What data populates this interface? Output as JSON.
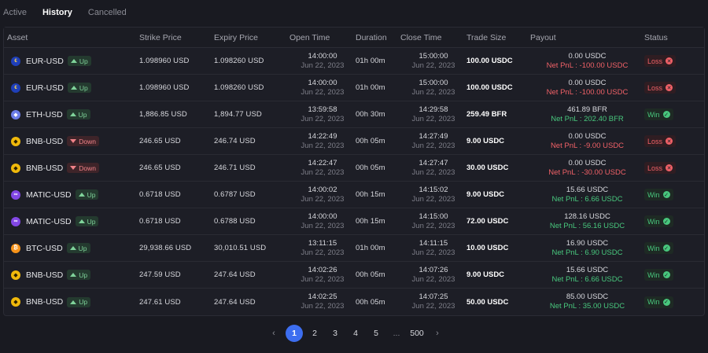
{
  "tabs": [
    {
      "label": "Active",
      "active": false
    },
    {
      "label": "History",
      "active": true
    },
    {
      "label": "Cancelled",
      "active": false
    }
  ],
  "columns": {
    "asset": "Asset",
    "strike": "Strike Price",
    "expiry": "Expiry Price",
    "open": "Open Time",
    "duration": "Duration",
    "close": "Close Time",
    "size": "Trade Size",
    "payout": "Payout",
    "status": "Status"
  },
  "rows": [
    {
      "coin": "eur",
      "coin_glyph": "€",
      "asset": "EUR-USD",
      "dir": "up",
      "dir_label": "Up",
      "strike": "1.098960 USD",
      "expiry": "1.098260 USD",
      "open_time": "14:00:00",
      "open_date": "Jun 22, 2023",
      "duration": "01h 00m",
      "close_time": "15:00:00",
      "close_date": "Jun 22, 2023",
      "size": "100.00 USDC",
      "payout": "0.00 USDC",
      "pnl": "Net PnL : -100.00 USDC",
      "result": "loss",
      "status": "Loss"
    },
    {
      "coin": "eur",
      "coin_glyph": "€",
      "asset": "EUR-USD",
      "dir": "up",
      "dir_label": "Up",
      "strike": "1.098960 USD",
      "expiry": "1.098260 USD",
      "open_time": "14:00:00",
      "open_date": "Jun 22, 2023",
      "duration": "01h 00m",
      "close_time": "15:00:00",
      "close_date": "Jun 22, 2023",
      "size": "100.00 USDC",
      "payout": "0.00 USDC",
      "pnl": "Net PnL : -100.00 USDC",
      "result": "loss",
      "status": "Loss"
    },
    {
      "coin": "eth",
      "coin_glyph": "◆",
      "asset": "ETH-USD",
      "dir": "up",
      "dir_label": "Up",
      "strike": "1,886.85 USD",
      "expiry": "1,894.77 USD",
      "open_time": "13:59:58",
      "open_date": "Jun 22, 2023",
      "duration": "00h 30m",
      "close_time": "14:29:58",
      "close_date": "Jun 22, 2023",
      "size": "259.49 BFR",
      "payout": "461.89 BFR",
      "pnl": "Net PnL : 202.40 BFR",
      "result": "win",
      "status": "Win"
    },
    {
      "coin": "bnb",
      "coin_glyph": "◆",
      "asset": "BNB-USD",
      "dir": "down",
      "dir_label": "Down",
      "strike": "246.65 USD",
      "expiry": "246.74 USD",
      "open_time": "14:22:49",
      "open_date": "Jun 22, 2023",
      "duration": "00h 05m",
      "close_time": "14:27:49",
      "close_date": "Jun 22, 2023",
      "size": "9.00 USDC",
      "payout": "0.00 USDC",
      "pnl": "Net PnL : -9.00 USDC",
      "result": "loss",
      "status": "Loss"
    },
    {
      "coin": "bnb",
      "coin_glyph": "◆",
      "asset": "BNB-USD",
      "dir": "down",
      "dir_label": "Down",
      "strike": "246.65 USD",
      "expiry": "246.71 USD",
      "open_time": "14:22:47",
      "open_date": "Jun 22, 2023",
      "duration": "00h 05m",
      "close_time": "14:27:47",
      "close_date": "Jun 22, 2023",
      "size": "30.00 USDC",
      "payout": "0.00 USDC",
      "pnl": "Net PnL : -30.00 USDC",
      "result": "loss",
      "status": "Loss"
    },
    {
      "coin": "matic",
      "coin_glyph": "∞",
      "asset": "MATIC-USD",
      "dir": "up",
      "dir_label": "Up",
      "strike": "0.6718 USD",
      "expiry": "0.6787 USD",
      "open_time": "14:00:02",
      "open_date": "Jun 22, 2023",
      "duration": "00h 15m",
      "close_time": "14:15:02",
      "close_date": "Jun 22, 2023",
      "size": "9.00 USDC",
      "payout": "15.66 USDC",
      "pnl": "Net PnL : 6.66 USDC",
      "result": "win",
      "status": "Win"
    },
    {
      "coin": "matic",
      "coin_glyph": "∞",
      "asset": "MATIC-USD",
      "dir": "up",
      "dir_label": "Up",
      "strike": "0.6718 USD",
      "expiry": "0.6788 USD",
      "open_time": "14:00:00",
      "open_date": "Jun 22, 2023",
      "duration": "00h 15m",
      "close_time": "14:15:00",
      "close_date": "Jun 22, 2023",
      "size": "72.00 USDC",
      "payout": "128.16 USDC",
      "pnl": "Net PnL : 56.16 USDC",
      "result": "win",
      "status": "Win"
    },
    {
      "coin": "btc",
      "coin_glyph": "₿",
      "asset": "BTC-USD",
      "dir": "up",
      "dir_label": "Up",
      "strike": "29,938.66 USD",
      "expiry": "30,010.51 USD",
      "open_time": "13:11:15",
      "open_date": "Jun 22, 2023",
      "duration": "01h 00m",
      "close_time": "14:11:15",
      "close_date": "Jun 22, 2023",
      "size": "10.00 USDC",
      "payout": "16.90 USDC",
      "pnl": "Net PnL : 6.90 USDC",
      "result": "win",
      "status": "Win"
    },
    {
      "coin": "bnb",
      "coin_glyph": "◆",
      "asset": "BNB-USD",
      "dir": "up",
      "dir_label": "Up",
      "strike": "247.59 USD",
      "expiry": "247.64 USD",
      "open_time": "14:02:26",
      "open_date": "Jun 22, 2023",
      "duration": "00h 05m",
      "close_time": "14:07:26",
      "close_date": "Jun 22, 2023",
      "size": "9.00 USDC",
      "payout": "15.66 USDC",
      "pnl": "Net PnL : 6.66 USDC",
      "result": "win",
      "status": "Win"
    },
    {
      "coin": "bnb",
      "coin_glyph": "◆",
      "asset": "BNB-USD",
      "dir": "up",
      "dir_label": "Up",
      "strike": "247.61 USD",
      "expiry": "247.64 USD",
      "open_time": "14:02:25",
      "open_date": "Jun 22, 2023",
      "duration": "00h 05m",
      "close_time": "14:07:25",
      "close_date": "Jun 22, 2023",
      "size": "50.00 USDC",
      "payout": "85.00 USDC",
      "pnl": "Net PnL : 35.00 USDC",
      "result": "win",
      "status": "Win"
    }
  ],
  "pagination": {
    "prev": "‹",
    "pages": [
      "1",
      "2",
      "3",
      "4",
      "5"
    ],
    "ellipsis": "...",
    "last": "500",
    "next": "›",
    "current": "1"
  },
  "colors": {
    "background": "#191a21",
    "accent": "#3d6ef0",
    "win": "#48c77d",
    "loss": "#f06167"
  }
}
